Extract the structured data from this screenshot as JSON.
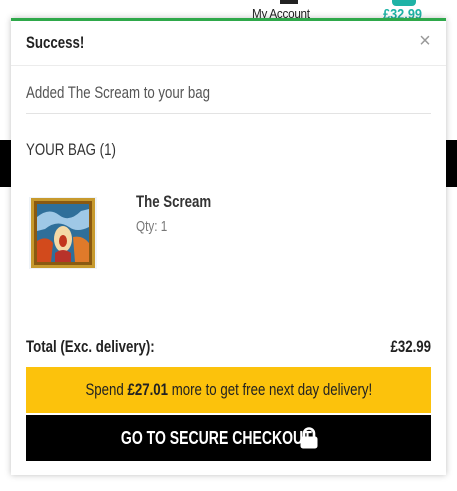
{
  "background": {
    "account_label": "My Account",
    "bag_total": "£32.99",
    "accent_color": "#1fb3a6"
  },
  "popup": {
    "title": "Success!",
    "close_icon": "×",
    "message": "Added The Scream to your bag",
    "bag_heading": "YOUR BAG (1)",
    "item": {
      "name": "The Scream",
      "qty": "Qty: 1",
      "thumbnail_icon": "framed-painting-icon"
    },
    "total_label": "Total (Exc. delivery):",
    "total_value": "£32.99",
    "promo": {
      "prefix": "Spend ",
      "amount": "£27.01",
      "suffix": " more to get free next day delivery!",
      "color": "#fcc20c"
    },
    "checkout_label": "GO TO SECURE CHECKOUT",
    "checkout_icon": "lock-icon",
    "success_color": "#2ea84a"
  }
}
